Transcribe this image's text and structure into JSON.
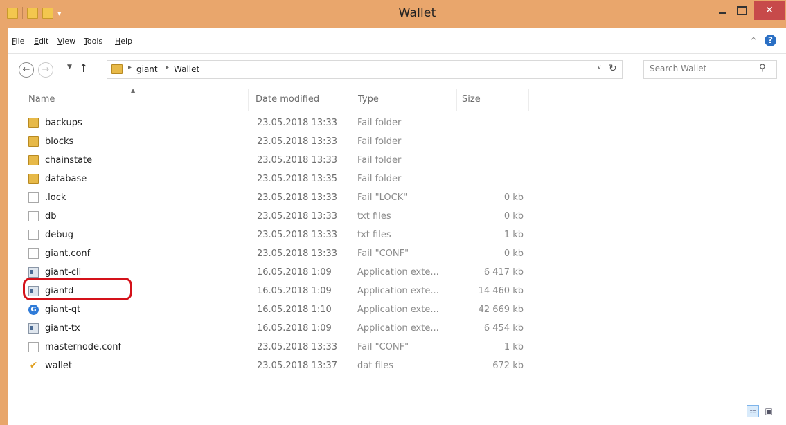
{
  "window": {
    "title": "Wallet"
  },
  "menu": [
    "File",
    "Edit",
    "View",
    "Tools",
    "Help"
  ],
  "address": {
    "crumbs": [
      "giant",
      "Wallet"
    ]
  },
  "search": {
    "placeholder": "Search Wallet"
  },
  "columns": {
    "name": "Name",
    "date": "Date modified",
    "type": "Type",
    "size": "Size"
  },
  "files": [
    {
      "name": "backups",
      "date": "23.05.2018 13:33",
      "type": "Fail folder",
      "size": "",
      "icon": "folder-icon"
    },
    {
      "name": "blocks",
      "date": "23.05.2018 13:33",
      "type": "Fail folder",
      "size": "",
      "icon": "folder-icon"
    },
    {
      "name": "chainstate",
      "date": "23.05.2018 13:33",
      "type": "Fail folder",
      "size": "",
      "icon": "folder-icon"
    },
    {
      "name": "database",
      "date": "23.05.2018 13:35",
      "type": "Fail folder",
      "size": "",
      "icon": "folder-icon"
    },
    {
      "name": ".lock",
      "date": "23.05.2018 13:33",
      "type": "Fail \"LOCK\"",
      "size": "0 kb",
      "icon": "file-icon"
    },
    {
      "name": "db",
      "date": "23.05.2018 13:33",
      "type": "txt files",
      "size": "0 kb",
      "icon": "text-file-icon"
    },
    {
      "name": "debug",
      "date": "23.05.2018 13:33",
      "type": "txt files",
      "size": "1 kb",
      "icon": "text-file-icon"
    },
    {
      "name": "giant.conf",
      "date": "23.05.2018 13:33",
      "type": "Fail \"CONF\"",
      "size": "0 kb",
      "icon": "file-icon"
    },
    {
      "name": "giant-cli",
      "date": "16.05.2018 1:09",
      "type": "Application exte...",
      "size": "6 417 kb",
      "icon": "application-icon"
    },
    {
      "name": "giantd",
      "date": "16.05.2018 1:09",
      "type": "Application exte...",
      "size": "14 460 kb",
      "icon": "application-icon"
    },
    {
      "name": "giant-qt",
      "date": "16.05.2018 1:10",
      "type": "Application exte...",
      "size": "42 669 kb",
      "icon": "giant-logo-icon"
    },
    {
      "name": "giant-tx",
      "date": "16.05.2018 1:09",
      "type": "Application exte...",
      "size": "6 454 kb",
      "icon": "application-icon"
    },
    {
      "name": "masternode.conf",
      "date": "23.05.2018 13:33",
      "type": "Fail \"CONF\"",
      "size": "1 kb",
      "icon": "file-icon"
    },
    {
      "name": "wallet",
      "date": "23.05.2018 13:37",
      "type": "dat files",
      "size": "672 kb",
      "icon": "checkmark-file-icon"
    }
  ],
  "highlighted_file": "masternode.conf",
  "colors": {
    "title_bar": "#e9a66c",
    "close_button": "#c74a4a",
    "highlight_outline": "#d4121a"
  }
}
